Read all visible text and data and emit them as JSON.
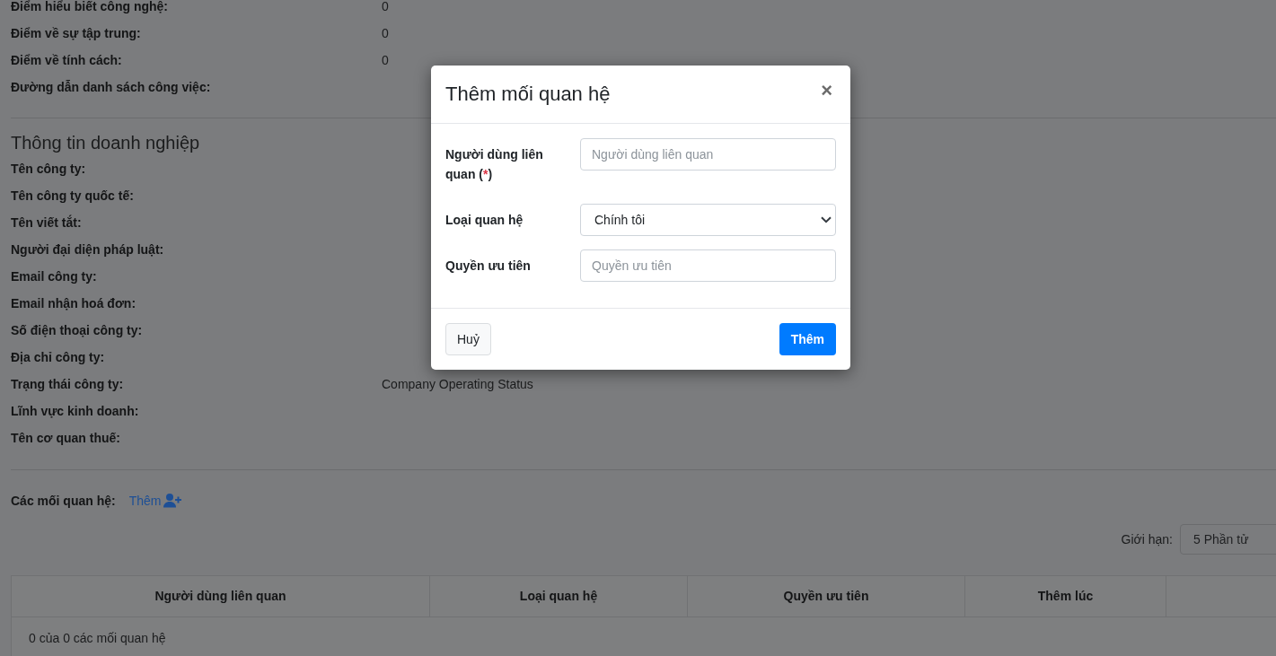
{
  "scores": [
    {
      "label": "Điểm hiểu biết công nghệ:",
      "value": "0"
    },
    {
      "label": "Điểm về sự tập trung:",
      "value": "0"
    },
    {
      "label": "Điểm về tính cách:",
      "value": "0"
    },
    {
      "label": "Đường dẫn danh sách công việc:"
    }
  ],
  "company_info": {
    "title": "Thông tin doanh nghiệp",
    "rows": [
      {
        "label": "Tên công ty:"
      },
      {
        "label": "Tên công ty quốc tế:"
      },
      {
        "label": "Tên viết tắt:"
      },
      {
        "label": "Người đại diện pháp luật:"
      },
      {
        "label": "Email công ty:"
      },
      {
        "label": "Email nhận hoá đơn:"
      },
      {
        "label": "Số điện thoại công ty:"
      },
      {
        "label": "Địa chỉ công ty:"
      },
      {
        "label": "Trạng thái công ty:",
        "value": "Company Operating Status"
      },
      {
        "label": "Lĩnh vực kinh doanh:"
      },
      {
        "label": "Tên cơ quan thuế:"
      }
    ]
  },
  "relations": {
    "label": "Các mối quan hệ:",
    "add_link": "Thêm",
    "limit": {
      "label": "Giới hạn:",
      "value": "5 Phần tử"
    },
    "table": {
      "columns": [
        "Người dùng liên quan",
        "Loại quan hệ",
        "Quyền ưu tiên",
        "Thêm lúc"
      ],
      "summary": "0 của 0 các mối quan hệ"
    }
  },
  "modal": {
    "title": "Thêm mối quan hệ",
    "close": "×",
    "fields": [
      {
        "kind": "text",
        "label": "Người dùng liên quan",
        "required": {
          "open": "(",
          "mark": "*",
          "close": ")"
        },
        "placeholder": "Người dùng liên quan"
      },
      {
        "kind": "select",
        "label": "Loại quan hệ",
        "value": "Chính tôi"
      },
      {
        "kind": "text",
        "label": "Quyền ưu tiên",
        "placeholder": "Quyền ưu tiên"
      }
    ],
    "buttons": [
      {
        "kind": "secondary",
        "label": "Huỷ"
      },
      {
        "kind": "primary",
        "label": "Thêm"
      }
    ]
  }
}
